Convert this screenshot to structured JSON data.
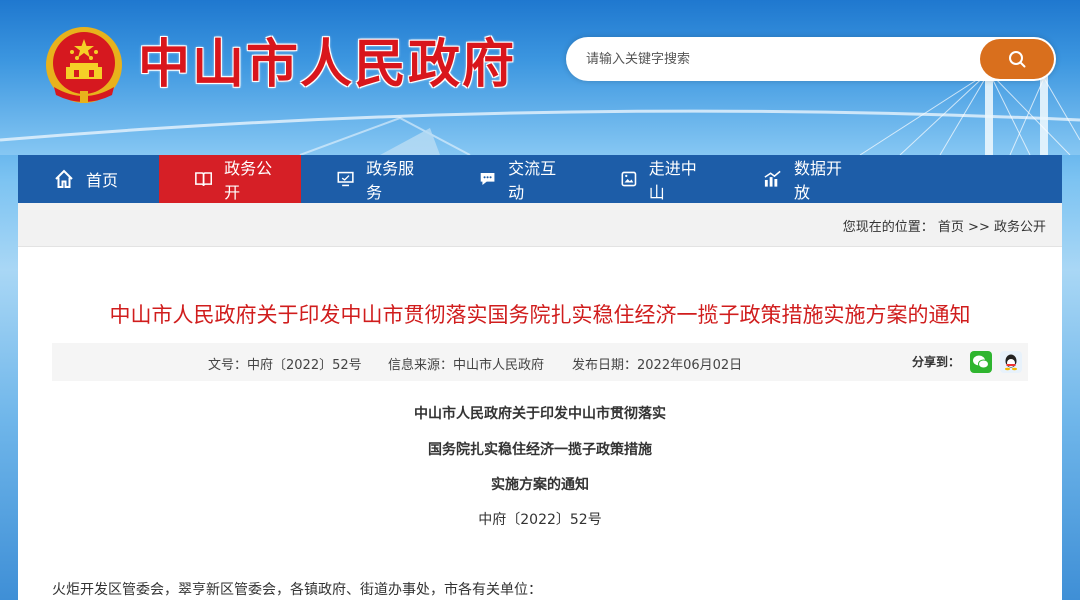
{
  "header": {
    "site_title": "中山市人民政府",
    "search": {
      "placeholder": "请输入关键字搜索"
    }
  },
  "nav": {
    "items": [
      {
        "label": "首页",
        "icon": "home-icon"
      },
      {
        "label": "政务公开",
        "icon": "book-icon",
        "active": true
      },
      {
        "label": "政务服务",
        "icon": "monitor-icon"
      },
      {
        "label": "交流互动",
        "icon": "chat-icon"
      },
      {
        "label": "走进中山",
        "icon": "picture-icon"
      },
      {
        "label": "数据开放",
        "icon": "bar-chart-icon"
      }
    ],
    "active_color": "#d61f26",
    "bar_color": "#1d5da8"
  },
  "breadcrumb": {
    "prefix": "您现在的位置：",
    "home": "首页",
    "separator": ">>",
    "current": "政务公开"
  },
  "document": {
    "title": "中山市人民政府关于印发中山市贯彻落实国务院扎实稳住经济一揽子政策措施实施方案的通知",
    "meta": {
      "doc_number": "文号：中府〔2022〕52号",
      "source": "信息来源：中山市人民政府",
      "publish_date": "发布日期：2022年06月02日",
      "share_label": "分享到："
    },
    "heading_lines": [
      "中山市人民政府关于印发中山市贯彻落实",
      "国务院扎实稳住经济一揽子政策措施",
      "实施方案的通知"
    ],
    "doc_number_center": "中府〔2022〕52号",
    "addressee": "火炬开发区管委会，翠亨新区管委会，各镇政府、街道办事处，市各有关单位："
  },
  "colors": {
    "title_red": "#d01d1d",
    "search_button": "#d96f1d"
  }
}
